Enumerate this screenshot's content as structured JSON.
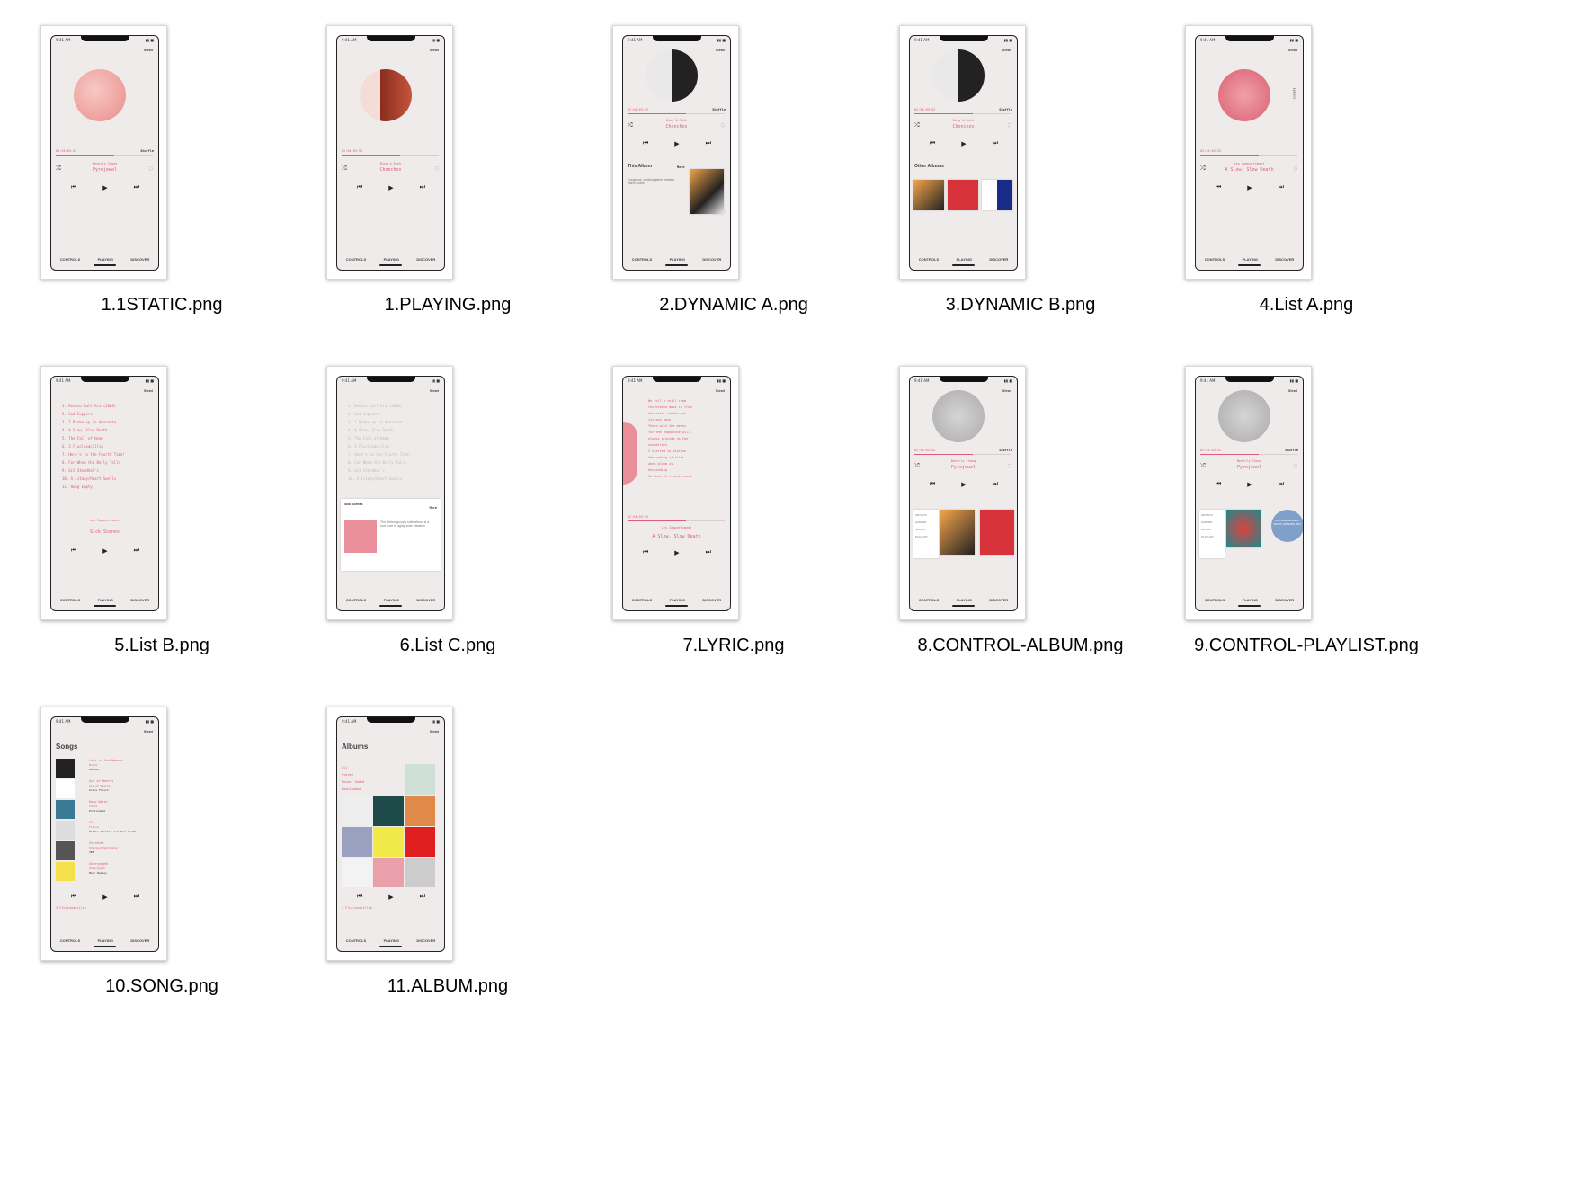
{
  "colors": {
    "accent": "#e05a82",
    "phone_bg": "#efebea",
    "caption": "#000000"
  },
  "files": [
    {
      "name": "1.1STATIC.png"
    },
    {
      "name": "1.PLAYING.png"
    },
    {
      "name": "2.DYNAMIC A.png"
    },
    {
      "name": "3.DYNAMIC B.png"
    },
    {
      "name": "4.List A.png"
    },
    {
      "name": "5.List B.png"
    },
    {
      "name": "6.List C.png"
    },
    {
      "name": "7.LYRIC.png"
    },
    {
      "name": "8.CONTROL-ALBUM.png"
    },
    {
      "name": "9.CONTROL-PLAYLIST.png"
    },
    {
      "name": "10.SONG.png"
    },
    {
      "name": "11.ALBUM.png"
    }
  ],
  "phone": {
    "time": "9:41 AM",
    "signal": "▮▮ ■",
    "user": "Xiewi",
    "tabs": [
      "CONTROLS",
      "PLAYING",
      "DISCOVER"
    ],
    "progress_time": "02:54:03:52",
    "shuffle": "Shuffle",
    "controls": [
      "⏮",
      "▶",
      "⏭"
    ],
    "shuffle_icon": "⤮",
    "repeat_icon": "◌"
  },
  "screens": {
    "s1": {
      "artist": "Beverly Chang",
      "title": "Pyrojewel"
    },
    "s2": {
      "artist": "Bing & Ruth",
      "title": "Chonchos"
    },
    "s3": {
      "artist": "Bing & Ruth",
      "title": "Chonchos",
      "section": "This Album",
      "more": "More",
      "desc": "Gorgeous, contemplative ambient piano suites"
    },
    "s4": {
      "artist": "Bing & Ruth",
      "title": "Chonchos",
      "section": "Other Albums"
    },
    "s5": {
      "artist": "Les Compartiment",
      "title": "A Slow, Slow Death",
      "side_label": "Lyrics"
    },
    "s6": {
      "tracks": [
        "1. Renato Dall'Ara (2008)",
        "2. Sad Suppers",
        "3. I Broke up in Amarante",
        "4. A Slow, Slow Death",
        "5. The Fall of Home",
        "6. 3 Flucloxacillin",
        "7. Here's to the Fourth Time!",
        "8. For Whom the Belly Tolls",
        "9. Git Stendhal's",
        "10. A Litany/Heart Swells",
        "11. Hung Empty"
      ],
      "artist": "Les Compartiment",
      "title": "Sick Scenes"
    },
    "s7": {
      "card_title": "Sick Scenes",
      "card_sub": "2017",
      "more": "More",
      "desc": "The British group's sixth album is a love note to aging indie idealism."
    },
    "s8": {
      "lyrics": [
        "We fell a chill from",
        "the breeze move in from",
        "the east. London put",
        "its own back",
        "Those with the means",
        "for the megaphone will",
        "always provide us the",
        "soundtrack",
        "I started to diarise",
        "the coming of files",
        "when gloom is",
        "descending",
        "So when it's back round"
      ],
      "artist": "Les Compartiment",
      "title": "A Slow, Slow Death"
    },
    "s9": {
      "artist": "Beverly Chang",
      "title": "Pyrojewel",
      "menu": [
        "ARTISTS",
        "ALBUMS",
        "SONGS",
        "PLAYLIST"
      ]
    },
    "s10": {
      "artist": "Beverly Chang",
      "title": "Pyrojewel",
      "menu": [
        "ARTISTS",
        "ALBUMS",
        "SONGS",
        "PLAYLIST"
      ],
      "badge": "AIM INDEPENDENT MUSIC AWARDS 2017"
    },
    "s11": {
      "heading": "Songs",
      "songs": [
        {
          "t": "Lost in the Moment",
          "a": "Bloom",
          "b": "Darius"
        },
        {
          "t": "Ace of Hearts",
          "a": "Ace of Hearts",
          "b": "Grace Frisch"
        },
        {
          "t": "Deep Water",
          "a": "Third",
          "b": "Portishead"
        },
        {
          "t": "A2",
          "a": "Trance",
          "b": "Ólafur Arnalds and Nils Frahm"
        },
        {
          "t": "Stardust",
          "a": "Stardust/Saltwater",
          "b": "3RE"
        },
        {
          "t": "Underghghh",
          "a": "Underghghh",
          "b": "Marc Wesley"
        }
      ],
      "now": "3 Flucloxacillin"
    },
    "s12": {
      "heading": "Albums",
      "filters": [
        "All",
        "Stared",
        "Recent Added",
        "Downloaded"
      ],
      "now": "3 Flucloxacillin"
    }
  }
}
